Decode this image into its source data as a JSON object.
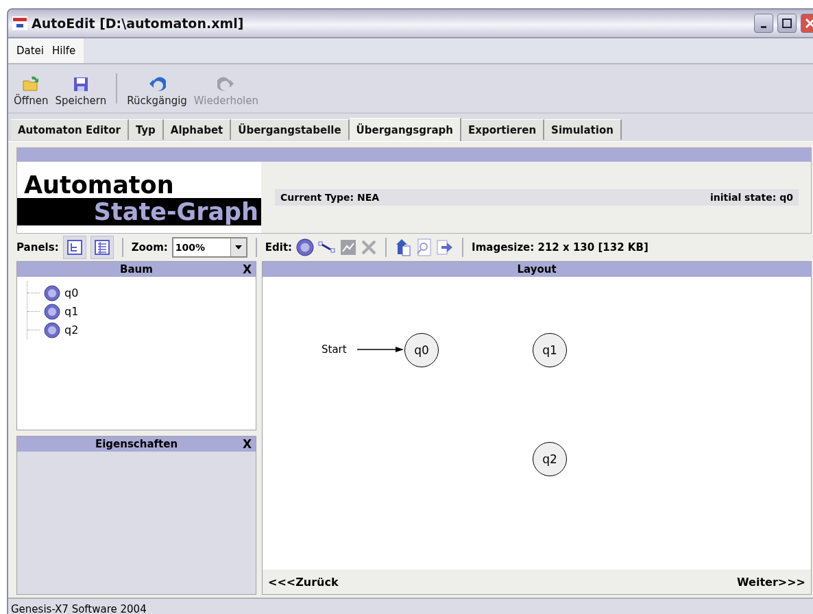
{
  "window": {
    "title": "AutoEdit [D:\\automaton.xml]"
  },
  "menu": [
    "Datei",
    "Hilfe"
  ],
  "toolbar": [
    {
      "kind": "open",
      "label": "Öffnen",
      "disabled": false
    },
    {
      "kind": "save",
      "label": "Speichern",
      "disabled": false
    },
    {
      "kind": "undo",
      "label": "Rückgängig",
      "disabled": false
    },
    {
      "kind": "redo",
      "label": "Wiederholen",
      "disabled": true
    }
  ],
  "tabs": [
    {
      "label": "Automaton Editor",
      "selected": false
    },
    {
      "label": "Typ",
      "selected": false
    },
    {
      "label": "Alphabet",
      "selected": false
    },
    {
      "label": "Übergangstabelle",
      "selected": false
    },
    {
      "label": "Übergangsgraph",
      "selected": true
    },
    {
      "label": "Exportieren",
      "selected": false
    },
    {
      "label": "Simulation",
      "selected": false
    }
  ],
  "header": {
    "logo_top": "Automaton",
    "logo_bottom": "State-Graph",
    "current_type": "Current Type: NEA",
    "initial_state": "initial state: q0"
  },
  "panel_toolbar": {
    "panels_label": "Panels:",
    "zoom_label": "Zoom:",
    "zoom_value": "100%",
    "edit_label": "Edit:",
    "imagesize": "Imagesize: 212 x 130 [132 KB]"
  },
  "tree": {
    "title": "Baum",
    "close": "X",
    "items": [
      "q0",
      "q1",
      "q2"
    ]
  },
  "properties": {
    "title": "Eigenschaften",
    "close": "X"
  },
  "layout": {
    "title": "Layout",
    "start_label": "Start",
    "states": [
      {
        "label": "q0",
        "initial": true
      },
      {
        "label": "q1",
        "initial": false
      },
      {
        "label": "q2",
        "initial": false
      }
    ],
    "back": "<<<Zurück",
    "next": "Weiter>>>"
  },
  "status_bar": "Genesis-X7 Software 2004"
}
